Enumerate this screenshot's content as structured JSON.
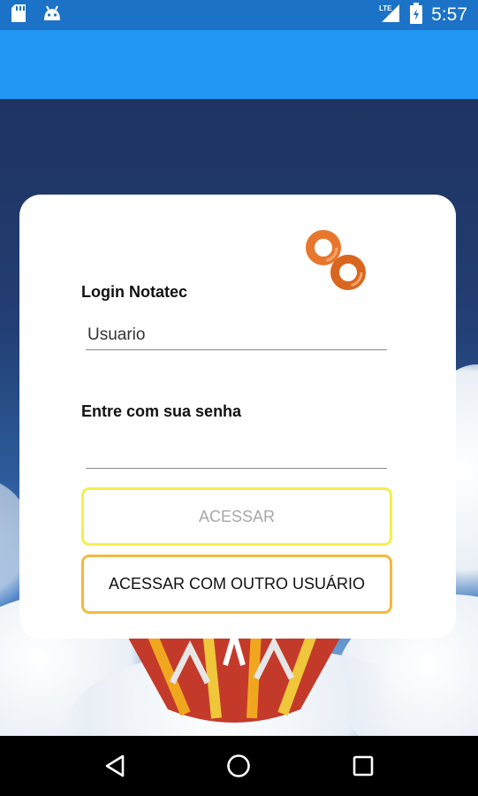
{
  "status_bar": {
    "time": "5:57",
    "network": "LTE",
    "icons": [
      "sd-card-icon",
      "android-icon",
      "lte-signal-icon",
      "battery-icon"
    ]
  },
  "login": {
    "title": "Login Notatec",
    "username_value": "Usuario",
    "password_label": "Entre com sua senha",
    "password_value": "",
    "access_button": "ACESSAR",
    "other_user_button": "ACESSAR COM OUTRO USUÁRIO"
  },
  "colors": {
    "status_bar": "#1b72c6",
    "app_bar": "#2196f3",
    "logo": "#e8772e",
    "primary_button_border": "#f4ef4c",
    "secondary_button_border": "#f4b942"
  },
  "nav": {
    "icons": [
      "back-icon",
      "home-icon",
      "recents-icon"
    ]
  }
}
